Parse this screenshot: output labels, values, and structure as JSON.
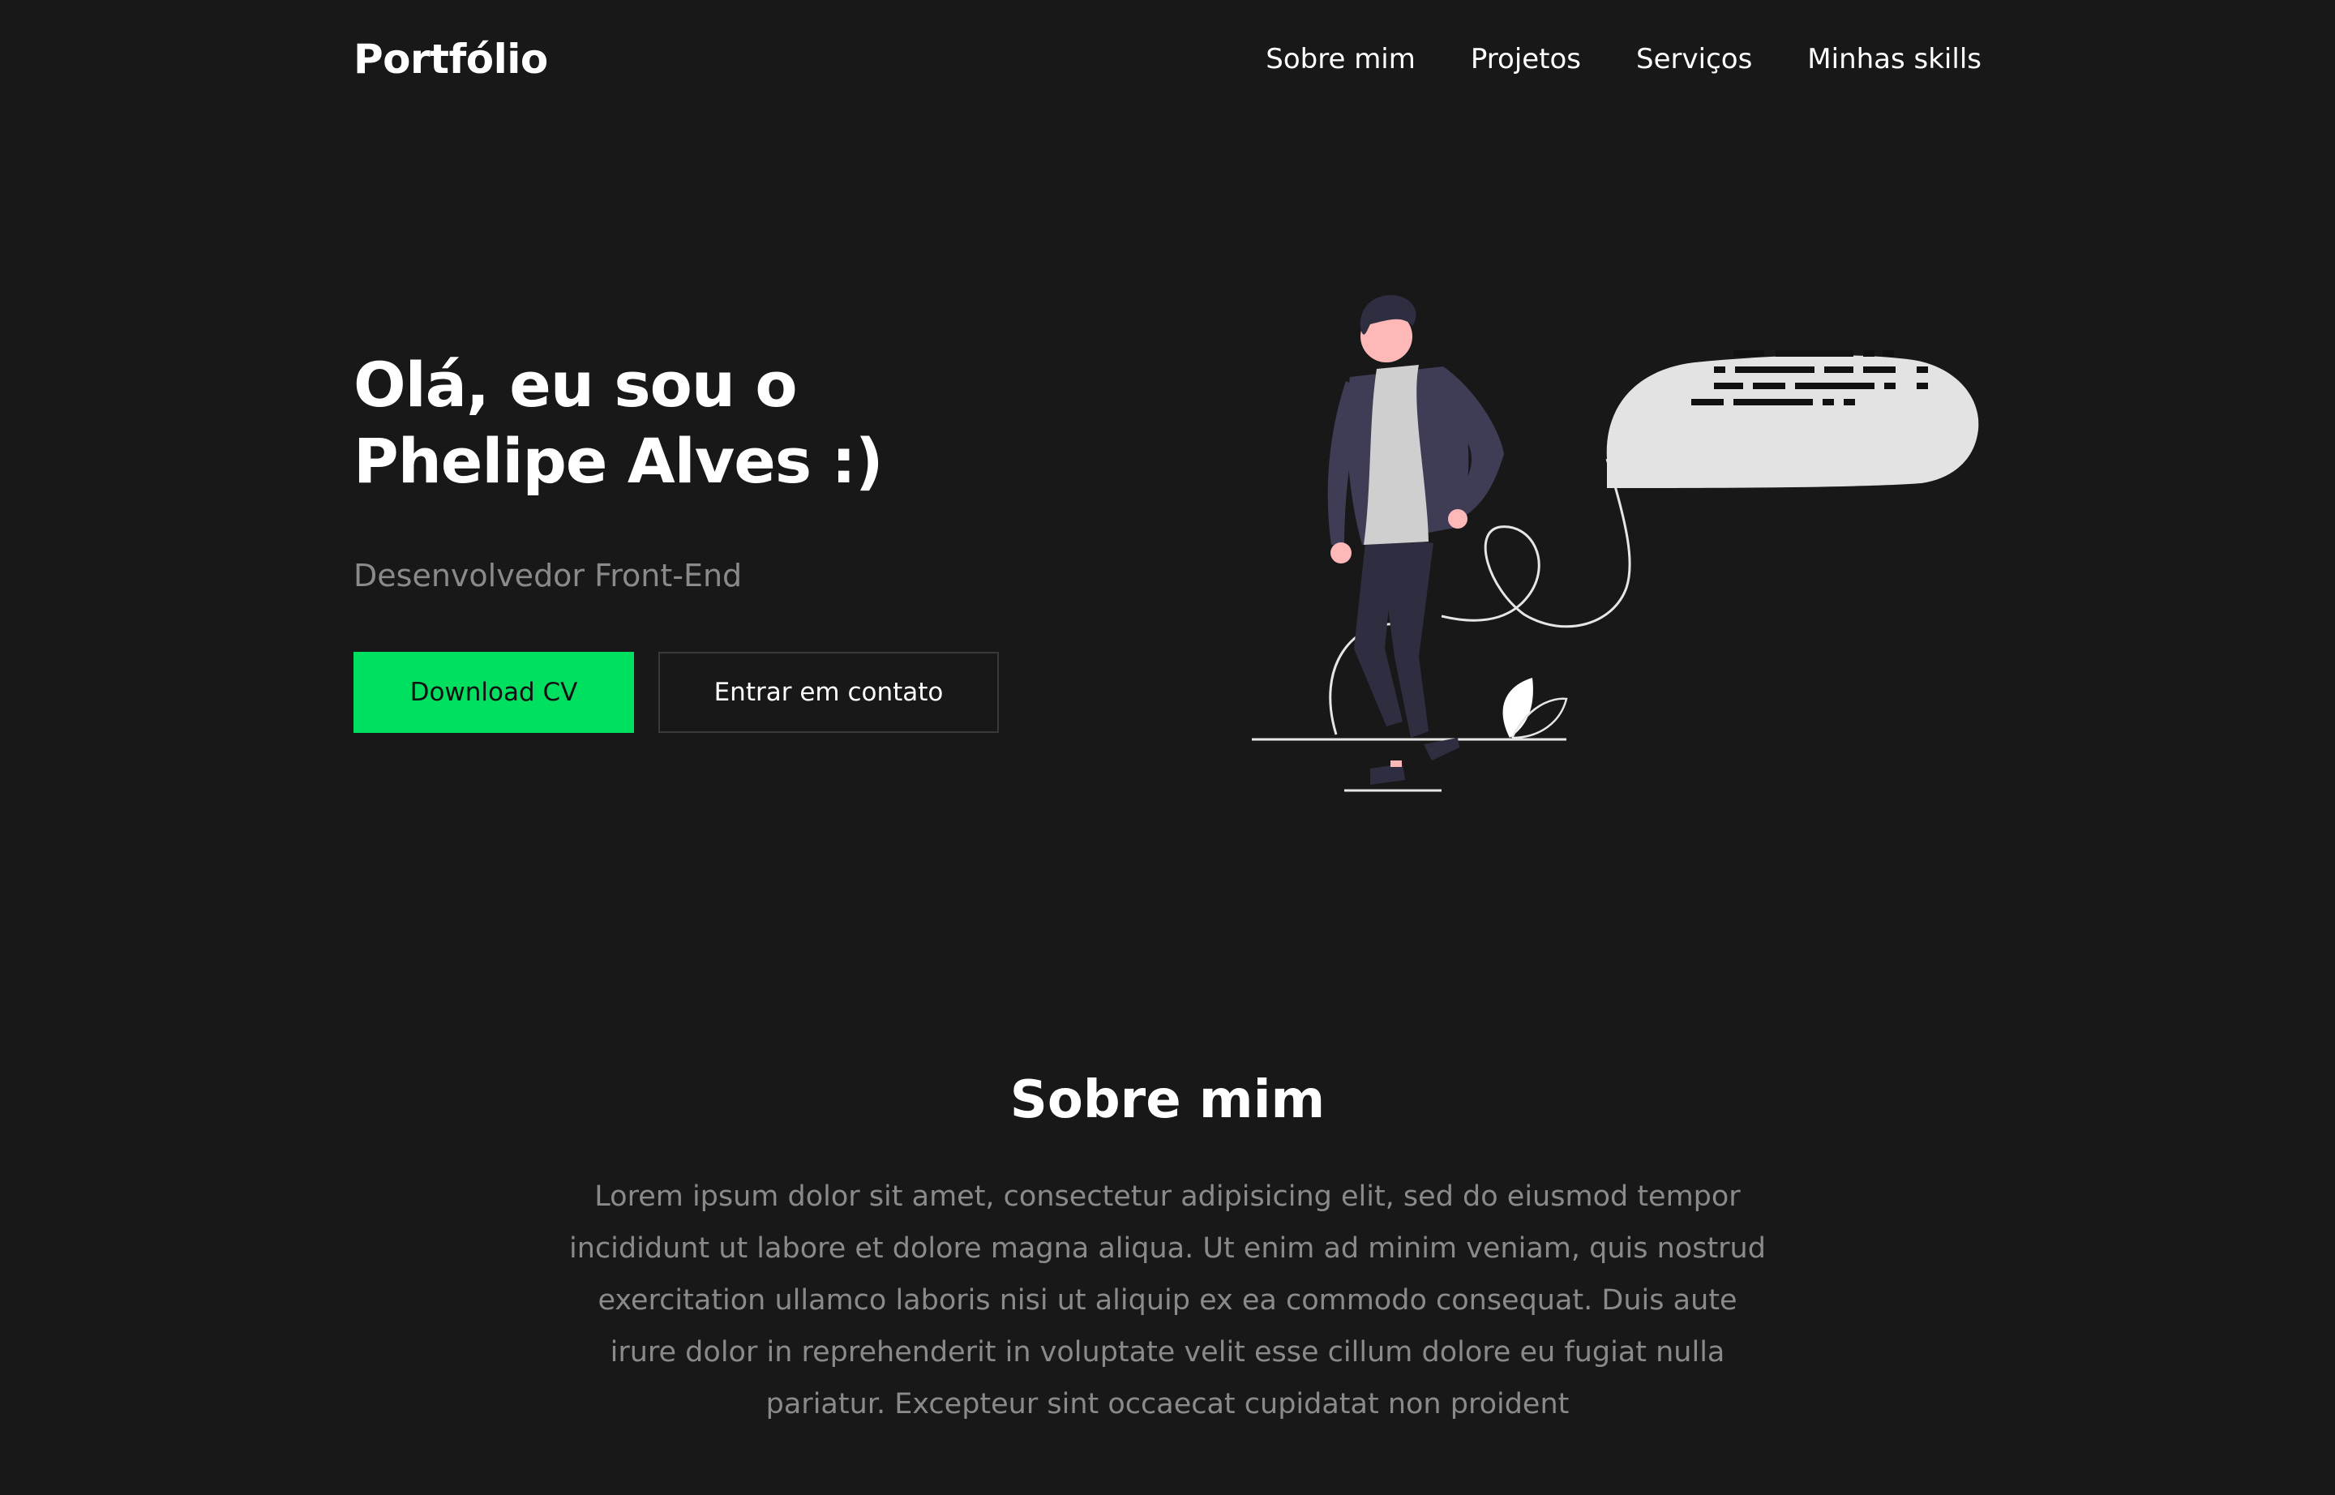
{
  "header": {
    "logo": "Portfólio",
    "nav": [
      "Sobre mim",
      "Projetos",
      "Serviços",
      "Minhas skills"
    ]
  },
  "hero": {
    "title_line1": "Olá, eu sou o",
    "title_line2": "Phelipe Alves :)",
    "subtitle": "Desenvolvedor Front-End",
    "download_button": "Download CV",
    "contact_button": "Entrar em contato"
  },
  "about": {
    "title": "Sobre mim",
    "text": "Lorem ipsum dolor sit amet, consectetur adipisicing elit, sed do eiusmod tempor incididunt ut labore et dolore magna aliqua. Ut enim ad minim veniam, quis nostrud exercitation ullamco laboris nisi ut aliquip ex ea commodo consequat. Duis aute irure dolor in reprehenderit in voluptate velit esse cillum dolore eu fugiat nulla pariatur. Excepteur sint occaecat cupidatat non proident"
  },
  "colors": {
    "background": "#181818",
    "accent": "#00e060",
    "muted_text": "#8a8a8a",
    "button_border": "#3a3a3a"
  }
}
